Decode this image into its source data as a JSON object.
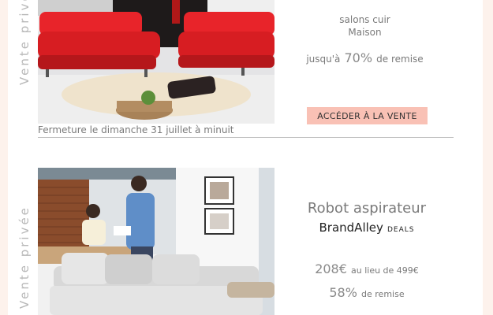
{
  "offers": [
    {
      "side_label": "Vente privée",
      "subtitle": "salons cuir",
      "subtitle2": "Maison",
      "discount_prefix": "jusqu'à",
      "discount_value": "70%",
      "discount_suffix": "de remise",
      "cta_label": "ACCÉDER À LA VENTE",
      "closing_text": "Fermeture le dimanche 31 juillet à minuit"
    },
    {
      "side_label": "Vente privée",
      "title": "Robot aspirateur",
      "brand": "BrandAlley",
      "brand_tag": "DEALS",
      "price": "208€",
      "price_suffix": "au lieu de 499€",
      "discount_value": "58%",
      "discount_suffix": "de remise"
    }
  ],
  "colors": {
    "background": "#fdf2ec",
    "cta": "#f9c1b5",
    "sofa_red": "#e8242a"
  }
}
